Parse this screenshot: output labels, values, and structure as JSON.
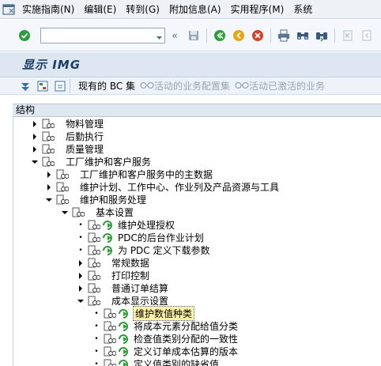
{
  "menu": {
    "items": [
      "实施指南(N)",
      "编辑(E)",
      "转到(G)",
      "附加信息(A)",
      "实用程序(M)",
      "系统"
    ]
  },
  "toolbar": {
    "command_value": "",
    "nav_back": "«"
  },
  "title": "显示 IMG",
  "app_toolbar": {
    "bc_set": "现有的 BC 集",
    "activity_bc_set": "活动的业务配置集",
    "activated_bc_set": "活动已激活的业务"
  },
  "tree": {
    "header": "结构",
    "nodes": [
      {
        "label": "物料管理"
      },
      {
        "label": "后勤执行"
      },
      {
        "label": "质量管理"
      },
      {
        "label": "工厂维护和客户服务"
      },
      {
        "label": "工厂维护和客户服务中的主数据"
      },
      {
        "label": "维护计划、工作中心、作业列及产品资源与工具"
      },
      {
        "label": "维护和服务处理"
      },
      {
        "label": "基本设置"
      },
      {
        "label": "维护处理授权"
      },
      {
        "label": "PDC的后台作业计划"
      },
      {
        "label": "为 PDC 定义下载参数"
      },
      {
        "label": "常规数据"
      },
      {
        "label": "打印控制"
      },
      {
        "label": "普通订单结算"
      },
      {
        "label": "成本显示设置"
      },
      {
        "label": "维护数值种类"
      },
      {
        "label": "将成本元素分配给值分类"
      },
      {
        "label": "检查值类别分配的一致性"
      },
      {
        "label": "定义订单成本估算的版本"
      },
      {
        "label": "定义值类别的缺省值"
      }
    ]
  },
  "colors": {
    "accent": "#1c3e66",
    "selection": "#fff3a8",
    "ok_green": "#2e9c3a",
    "cancel_red": "#d2402a",
    "exit_orange": "#e8a417"
  }
}
